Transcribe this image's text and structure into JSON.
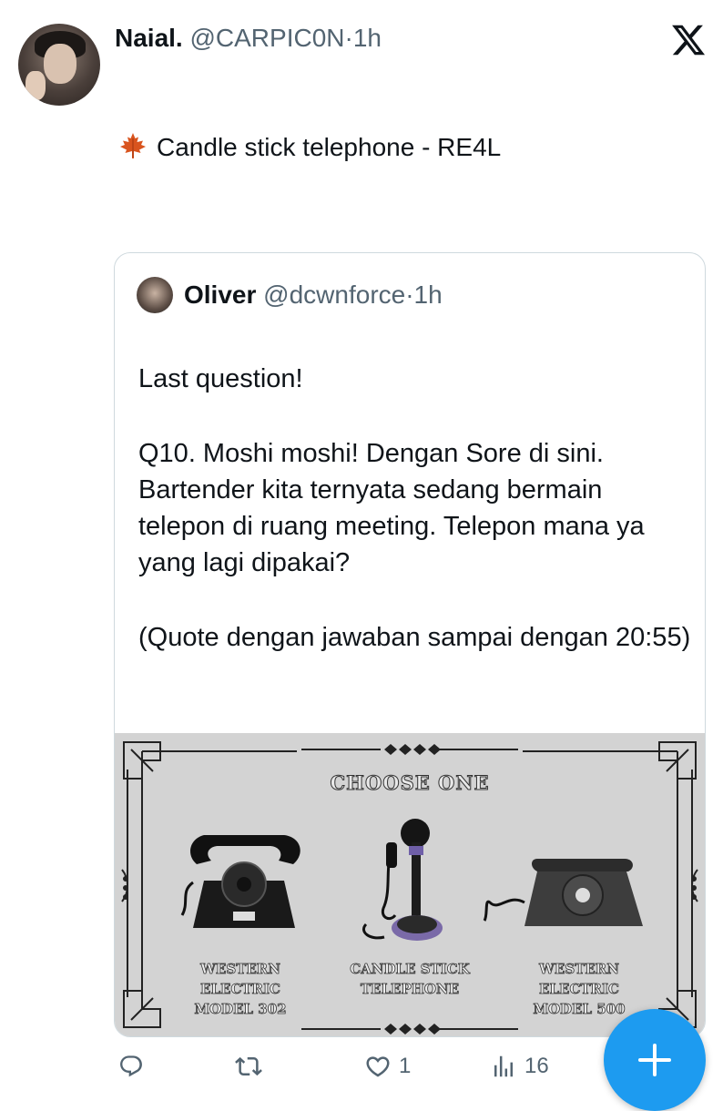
{
  "tweet": {
    "display_name": "Naial.",
    "handle": "@CARPIC0N",
    "time": "1h",
    "text": "Candle stick telephone - RE4L",
    "emoji": "maple-leaf-icon"
  },
  "quote": {
    "display_name": "Oliver",
    "handle": "@dcwnforce",
    "time": "1h",
    "body": [
      "Last question!",
      "Q10. Moshi moshi! Dengan Sore di sini. Bartender kita ternyata sedang bermain telepon di ruang meeting. Telepon mana ya yang lagi dipakai?",
      "(Quote dengan jawaban sampai dengan 20:55)"
    ],
    "image": {
      "heading": "CHOOSE ONE",
      "options": [
        {
          "line1": "WESTERN ELECTRIC",
          "line2": "MODEL 302"
        },
        {
          "line1": "CANDLE STICK",
          "line2": "TELEPHONE"
        },
        {
          "line1": "WESTERN ELECTRIC",
          "line2": "MODEL 500"
        }
      ]
    }
  },
  "actions": {
    "reply_count": "",
    "retweet_count": "",
    "like_count": "1",
    "views_count": "16"
  },
  "colors": {
    "accent": "#1d9bf0",
    "text": "#0f1419",
    "secondary": "#536471"
  }
}
